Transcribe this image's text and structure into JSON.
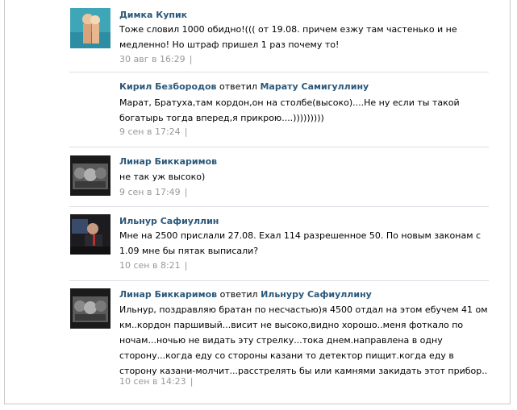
{
  "comments": [
    {
      "author": "Димка Купик",
      "replied": "",
      "reply_to": "",
      "text": "Тоже словил 1000 обидно!((( от 19.08. причем езжу там частенько и не медленно! Но штраф пришел 1 раз почему то!",
      "date": "30 авг в 16:29",
      "separator": "|",
      "has_avatar": true
    },
    {
      "author": "Кирил Безбородов",
      "replied": "ответил",
      "reply_to": "Марату Самигуллину",
      "text": "Марат, Братуха,там кордон,он на столбе(высоко)....Не ну если ты такой богатырь тогда вперед,я прикрою....)))))))))",
      "date": "9 сен в 17:24",
      "separator": "|",
      "has_avatar": false
    },
    {
      "author": "Линар Биккаримов",
      "replied": "",
      "reply_to": "",
      "text": "не так уж высоко)",
      "date": "9 сен в 17:49",
      "separator": "|",
      "has_avatar": true
    },
    {
      "author": "Ильнур Сафиуллин",
      "replied": "",
      "reply_to": "",
      "text": "Мне на 2500 прислали 27.08. Ехал 114 разрешенное 50. По новым законам с 1.09 мне бы пятак выписали?",
      "date": "10 сен в 8:21",
      "separator": "|",
      "has_avatar": true
    },
    {
      "author": "Линар Биккаримов",
      "replied": "ответил",
      "reply_to": "Ильнуру Сафиуллину",
      "text": "Ильнур, поздравляю братан по несчастью)я 4500 отдал на этом ебучем 41 ом км..кордон паршивый...висит не высоко,видно хорошо..меня фоткало по ночам...ночью не видать эту стрелку...тока днем.направлена в одну сторону...когда еду со стороны казани то детектор пищит.когда еду в сторону казани-молчит...расстрелять бы или камнями закидать этот прибор..",
      "date": "10 сен в 14:23",
      "separator": "|",
      "has_avatar": true
    }
  ]
}
